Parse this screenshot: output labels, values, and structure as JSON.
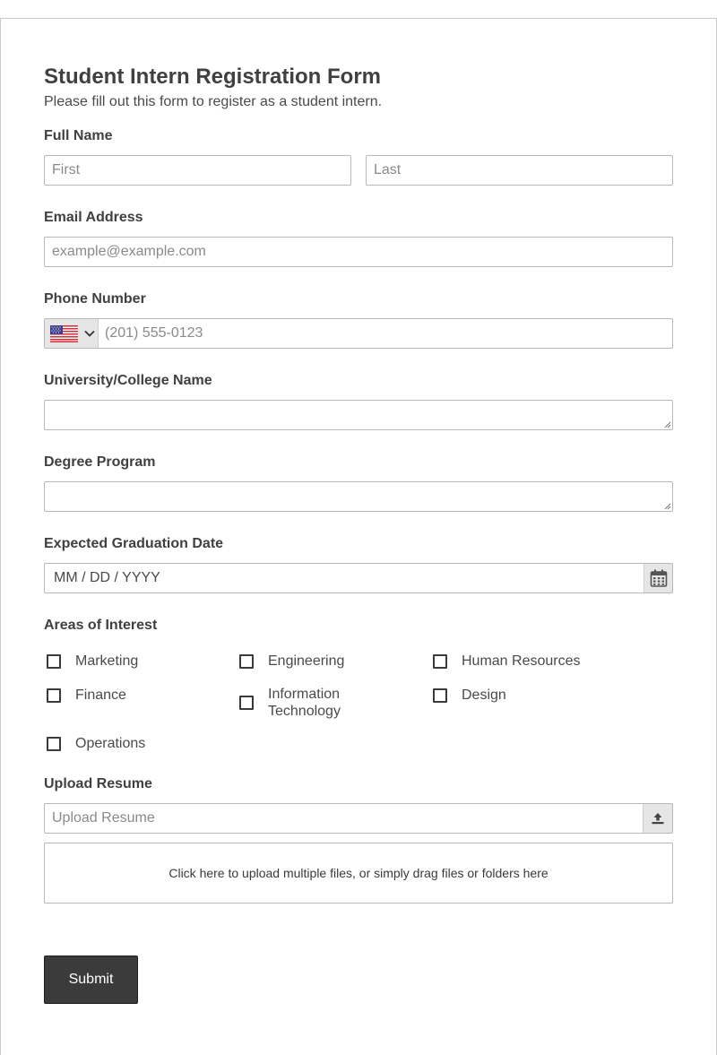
{
  "form": {
    "title": "Student Intern Registration Form",
    "subtitle": "Please fill out this form to register as a student intern."
  },
  "full_name": {
    "label": "Full Name",
    "first_placeholder": "First",
    "last_placeholder": "Last"
  },
  "email": {
    "label": "Email Address",
    "placeholder": "example@example.com"
  },
  "phone": {
    "label": "Phone Number",
    "country_icon": "us-flag-icon",
    "placeholder": "(201) 555-0123"
  },
  "university": {
    "label": "University/College Name",
    "value": ""
  },
  "degree": {
    "label": "Degree Program",
    "value": ""
  },
  "graduation": {
    "label": "Expected Graduation Date",
    "placeholder": "MM / DD / YYYY",
    "icon": "calendar-icon"
  },
  "interests": {
    "label": "Areas of Interest",
    "options": [
      {
        "label": "Marketing",
        "checked": false
      },
      {
        "label": "Engineering",
        "checked": false
      },
      {
        "label": "Human Resources",
        "checked": false
      },
      {
        "label": "Finance",
        "checked": false
      },
      {
        "label": "Information Technology",
        "checked": false
      },
      {
        "label": "Design",
        "checked": false
      },
      {
        "label": "Operations",
        "checked": false
      }
    ]
  },
  "resume": {
    "label": "Upload Resume",
    "placeholder": "Upload Resume",
    "icon": "upload-icon",
    "dropzone_text": "Click here to upload multiple files, or simply drag files or folders here"
  },
  "submit": {
    "label": "Submit"
  },
  "colors": {
    "button_bg": "#3b3b3b",
    "border": "#b8b8b8",
    "text": "#404040",
    "addon_bg": "#e6e6e6"
  }
}
